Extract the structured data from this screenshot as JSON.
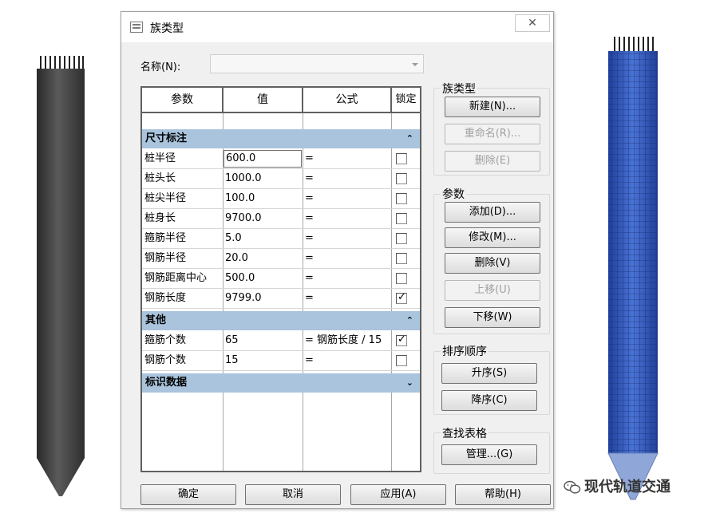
{
  "dialog": {
    "title": "族类型",
    "close_glyph": "✕",
    "name_label": "名称(N):",
    "name_value": ""
  },
  "grid": {
    "headers": [
      "参数",
      "值",
      "公式",
      "锁定"
    ],
    "groups": [
      {
        "label": "尺寸标注",
        "toggle": "⌃",
        "rows": [
          {
            "param": "桩半径",
            "value": "600.0",
            "formula": "=",
            "locked": false
          },
          {
            "param": "桩头长",
            "value": "1000.0",
            "formula": "=",
            "locked": false
          },
          {
            "param": "桩尖半径",
            "value": "100.0",
            "formula": "=",
            "locked": false
          },
          {
            "param": "桩身长",
            "value": "9700.0",
            "formula": "=",
            "locked": false
          },
          {
            "param": "箍筋半径",
            "value": "5.0",
            "formula": "=",
            "locked": false
          },
          {
            "param": "钢筋半径",
            "value": "20.0",
            "formula": "=",
            "locked": false
          },
          {
            "param": "钢筋距离中心",
            "value": "500.0",
            "formula": "=",
            "locked": false
          },
          {
            "param": "钢筋长度",
            "value": "9799.0",
            "formula": "=",
            "locked": true
          }
        ]
      },
      {
        "label": "其他",
        "toggle": "⌃",
        "rows": [
          {
            "param": "箍筋个数",
            "value": "65",
            "formula": "= 钢筋长度 / 15",
            "locked": true
          },
          {
            "param": "钢筋个数",
            "value": "15",
            "formula": "=",
            "locked": false
          }
        ]
      },
      {
        "label": "标识数据",
        "toggle": "⌄",
        "rows": []
      }
    ]
  },
  "family_types": {
    "title": "族类型",
    "new": "新建(N)...",
    "rename": "重命名(R)...",
    "delete": "删除(E)"
  },
  "parameters": {
    "title": "参数",
    "add": "添加(D)...",
    "modify": "修改(M)...",
    "delete": "删除(V)",
    "move_up": "上移(U)",
    "move_down": "下移(W)"
  },
  "sort_order": {
    "title": "排序顺序",
    "ascending": "升序(S)",
    "descending": "降序(C)"
  },
  "lookup_tables": {
    "title": "查找表格",
    "manage": "管理...(G)"
  },
  "footer": {
    "ok": "确定",
    "cancel": "取消",
    "apply": "应用(A)",
    "help": "帮助(H)"
  },
  "watermark": {
    "text": "现代轨道交通"
  },
  "colors": {
    "group_header": "#a9c4dc",
    "left_pile": "#3a3a3a",
    "right_pile": "#2f56b8"
  }
}
